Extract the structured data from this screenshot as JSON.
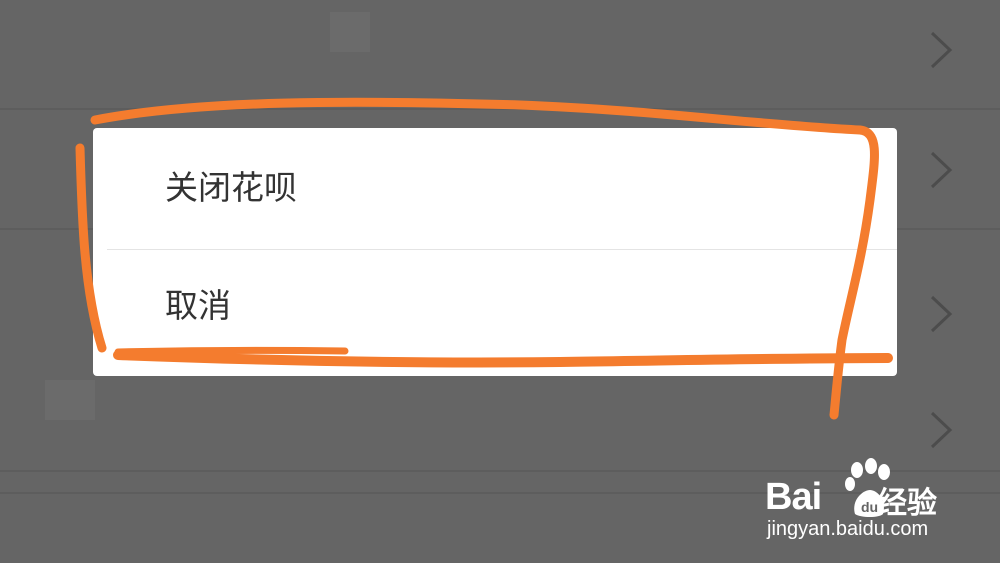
{
  "dialog": {
    "items": [
      {
        "label": "关闭花呗"
      },
      {
        "label": "取消"
      }
    ]
  },
  "watermark": {
    "brand": "Bai",
    "brand_suffix": "经验",
    "url": "jingyan.baidu.com"
  },
  "colors": {
    "overlay": "#656565",
    "sheet": "#ffffff",
    "annotation": "#f47c2e",
    "text": "#333333"
  },
  "icons": {
    "row_chevron": "chevron-right-icon",
    "watermark_paw": "baidu-paw-icon"
  }
}
